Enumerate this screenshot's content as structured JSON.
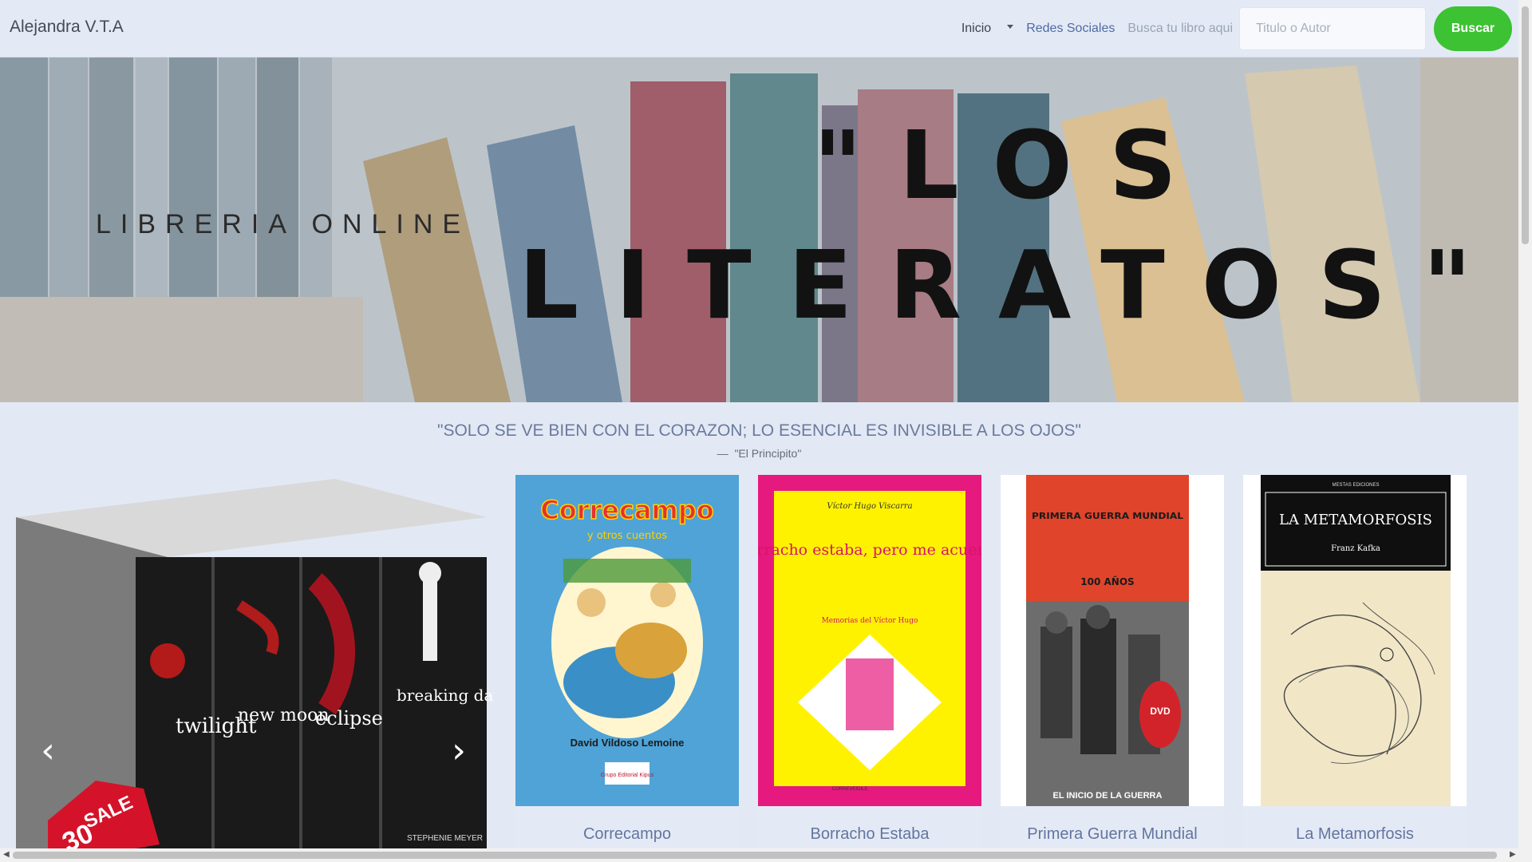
{
  "navbar": {
    "brand": "Alejandra V.T.A",
    "home_label": "Inicio",
    "social_label": "Redes Sociales",
    "search_hint": "Busca tu libro aqui",
    "search_placeholder": "Titulo o Autor",
    "search_button": "Buscar"
  },
  "hero": {
    "subtitle": "LIBRERIA ONLINE",
    "title": "\"LOS LITERATOS\""
  },
  "quote": {
    "text": "\"SOLO SE VE BIEN CON EL CORAZON; LO ESENCIAL ES INVISIBLE A LOS OJOS\"",
    "source": "\"El Principito\"",
    "dash": "—"
  },
  "carousel": {
    "prev_label": "‹",
    "next_label": "›",
    "box_titles": [
      "twilight",
      "new moon",
      "eclipse",
      "breaking dawn"
    ],
    "author": "STEPHENIE MEYER",
    "sale_text": "SALE",
    "sale_value": "30"
  },
  "books": [
    {
      "title": "Correcampo",
      "cover_title": "Correcampo",
      "cover_sub": "y otros cuentos",
      "cover_author": "David Vildoso Lemoine",
      "publisher": "Grupo Editorial Kipus"
    },
    {
      "title": "Borracho Estaba",
      "cover_author": "Víctor Hugo Viscarra",
      "cover_title": "Borracho estaba, pero me acuerdo",
      "cover_sub": "Memorias del Víctor Hugo",
      "publisher": "CORREVEIDILE"
    },
    {
      "title": "Primera Guerra Mundial",
      "cover_title": "PRIMERA GUERRA MUNDIAL",
      "cover_sub": "100 AÑOS",
      "cover_footer": "EL INICIO DE LA GUERRA",
      "badge": "DVD"
    },
    {
      "title": "La Metamorfosis",
      "cover_title": "LA METAMORFOSIS",
      "cover_author": "Franz Kafka",
      "publisher": "MESTAS EDICIONES"
    }
  ],
  "colors": {
    "search_button": "#3cc233",
    "background": "#e2e9f4",
    "caption_text": "#6275a0"
  }
}
